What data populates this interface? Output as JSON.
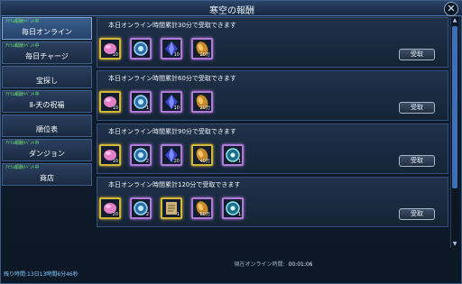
{
  "window": {
    "title": "寒空の報酬"
  },
  "sidebar": {
    "items": [
      {
        "tag": "ｱｲﾃﾑ報酬ｲﾍﾞﾝﾄ中",
        "label": "毎日オンライン",
        "active": true
      },
      {
        "tag": "ｱｲﾃﾑ報酬ｲﾍﾞﾝﾄ中",
        "label": "毎日チャージ",
        "active": false
      },
      {
        "tag": "",
        "label": "宝探し",
        "active": false
      },
      {
        "tag": "ｱｲﾃﾑ報酬ｲﾍﾞﾝﾄ中",
        "label": "Ⅱ-天の祝福",
        "active": false
      },
      {
        "tag": "",
        "label": "順位表",
        "active": false
      },
      {
        "tag": "ｱｲﾃﾑ報酬ｲﾍﾞﾝﾄ中",
        "label": "ダンジョン",
        "active": false
      },
      {
        "tag": "ｱｲﾃﾑ報酬ｲﾍﾞﾝﾄ中",
        "label": "商店",
        "active": false
      }
    ],
    "footer": "残り時間:13日13時間6分46秒"
  },
  "rewards": [
    {
      "text": "本日オンライン時間累計30分で受取できます",
      "button": "受取",
      "items": [
        {
          "icon": "pink-gem-icon",
          "count": "10",
          "frame": "gold"
        },
        {
          "icon": "blue-medal-icon",
          "count": "",
          "frame": "purple"
        },
        {
          "icon": "blue-crystal-icon",
          "count": "10",
          "frame": "purple"
        },
        {
          "icon": "gold-coin-icon",
          "count": "20万",
          "frame": "purple"
        }
      ]
    },
    {
      "text": "本日オンライン時間累計60分で受取できます",
      "button": "受取",
      "items": [
        {
          "icon": "pink-gem-icon",
          "count": "10",
          "frame": "gold"
        },
        {
          "icon": "blue-medal-icon",
          "count": "1",
          "frame": "purple"
        },
        {
          "icon": "blue-crystal-icon",
          "count": "10",
          "frame": "purple"
        },
        {
          "icon": "gold-coin-icon",
          "count": "20万",
          "frame": "purple"
        }
      ]
    },
    {
      "text": "本日オンライン時間累計90分で受取できます",
      "button": "受取",
      "items": [
        {
          "icon": "pink-gem-icon",
          "count": "10",
          "frame": "gold"
        },
        {
          "icon": "blue-medal-icon",
          "count": "2",
          "frame": "purple"
        },
        {
          "icon": "blue-crystal-icon",
          "count": "20",
          "frame": "purple"
        },
        {
          "icon": "gold-coin-icon",
          "count": "40万",
          "frame": "gold"
        },
        {
          "icon": "teal-orb-icon",
          "count": "1",
          "frame": "purple"
        }
      ]
    },
    {
      "text": "本日オンライン時間累計120分で受取できます",
      "button": "受取",
      "items": [
        {
          "icon": "pink-gem-icon",
          "count": "20",
          "frame": "gold"
        },
        {
          "icon": "blue-medal-icon",
          "count": "2",
          "frame": "purple"
        },
        {
          "icon": "scroll-item-icon",
          "count": "1",
          "frame": "gold"
        },
        {
          "icon": "gold-coin-icon",
          "count": "60万",
          "frame": "purple"
        },
        {
          "icon": "teal-orb-icon",
          "count": "1",
          "frame": "purple"
        }
      ]
    }
  ],
  "status": {
    "label": "現在オンライン時間",
    "time": "00:01:06"
  },
  "colors": {
    "gold_frame": "#d2b73a",
    "purple_frame": "#b07ad8",
    "tag_green": "#70e070",
    "accent_blue": "#3c6fb8"
  }
}
